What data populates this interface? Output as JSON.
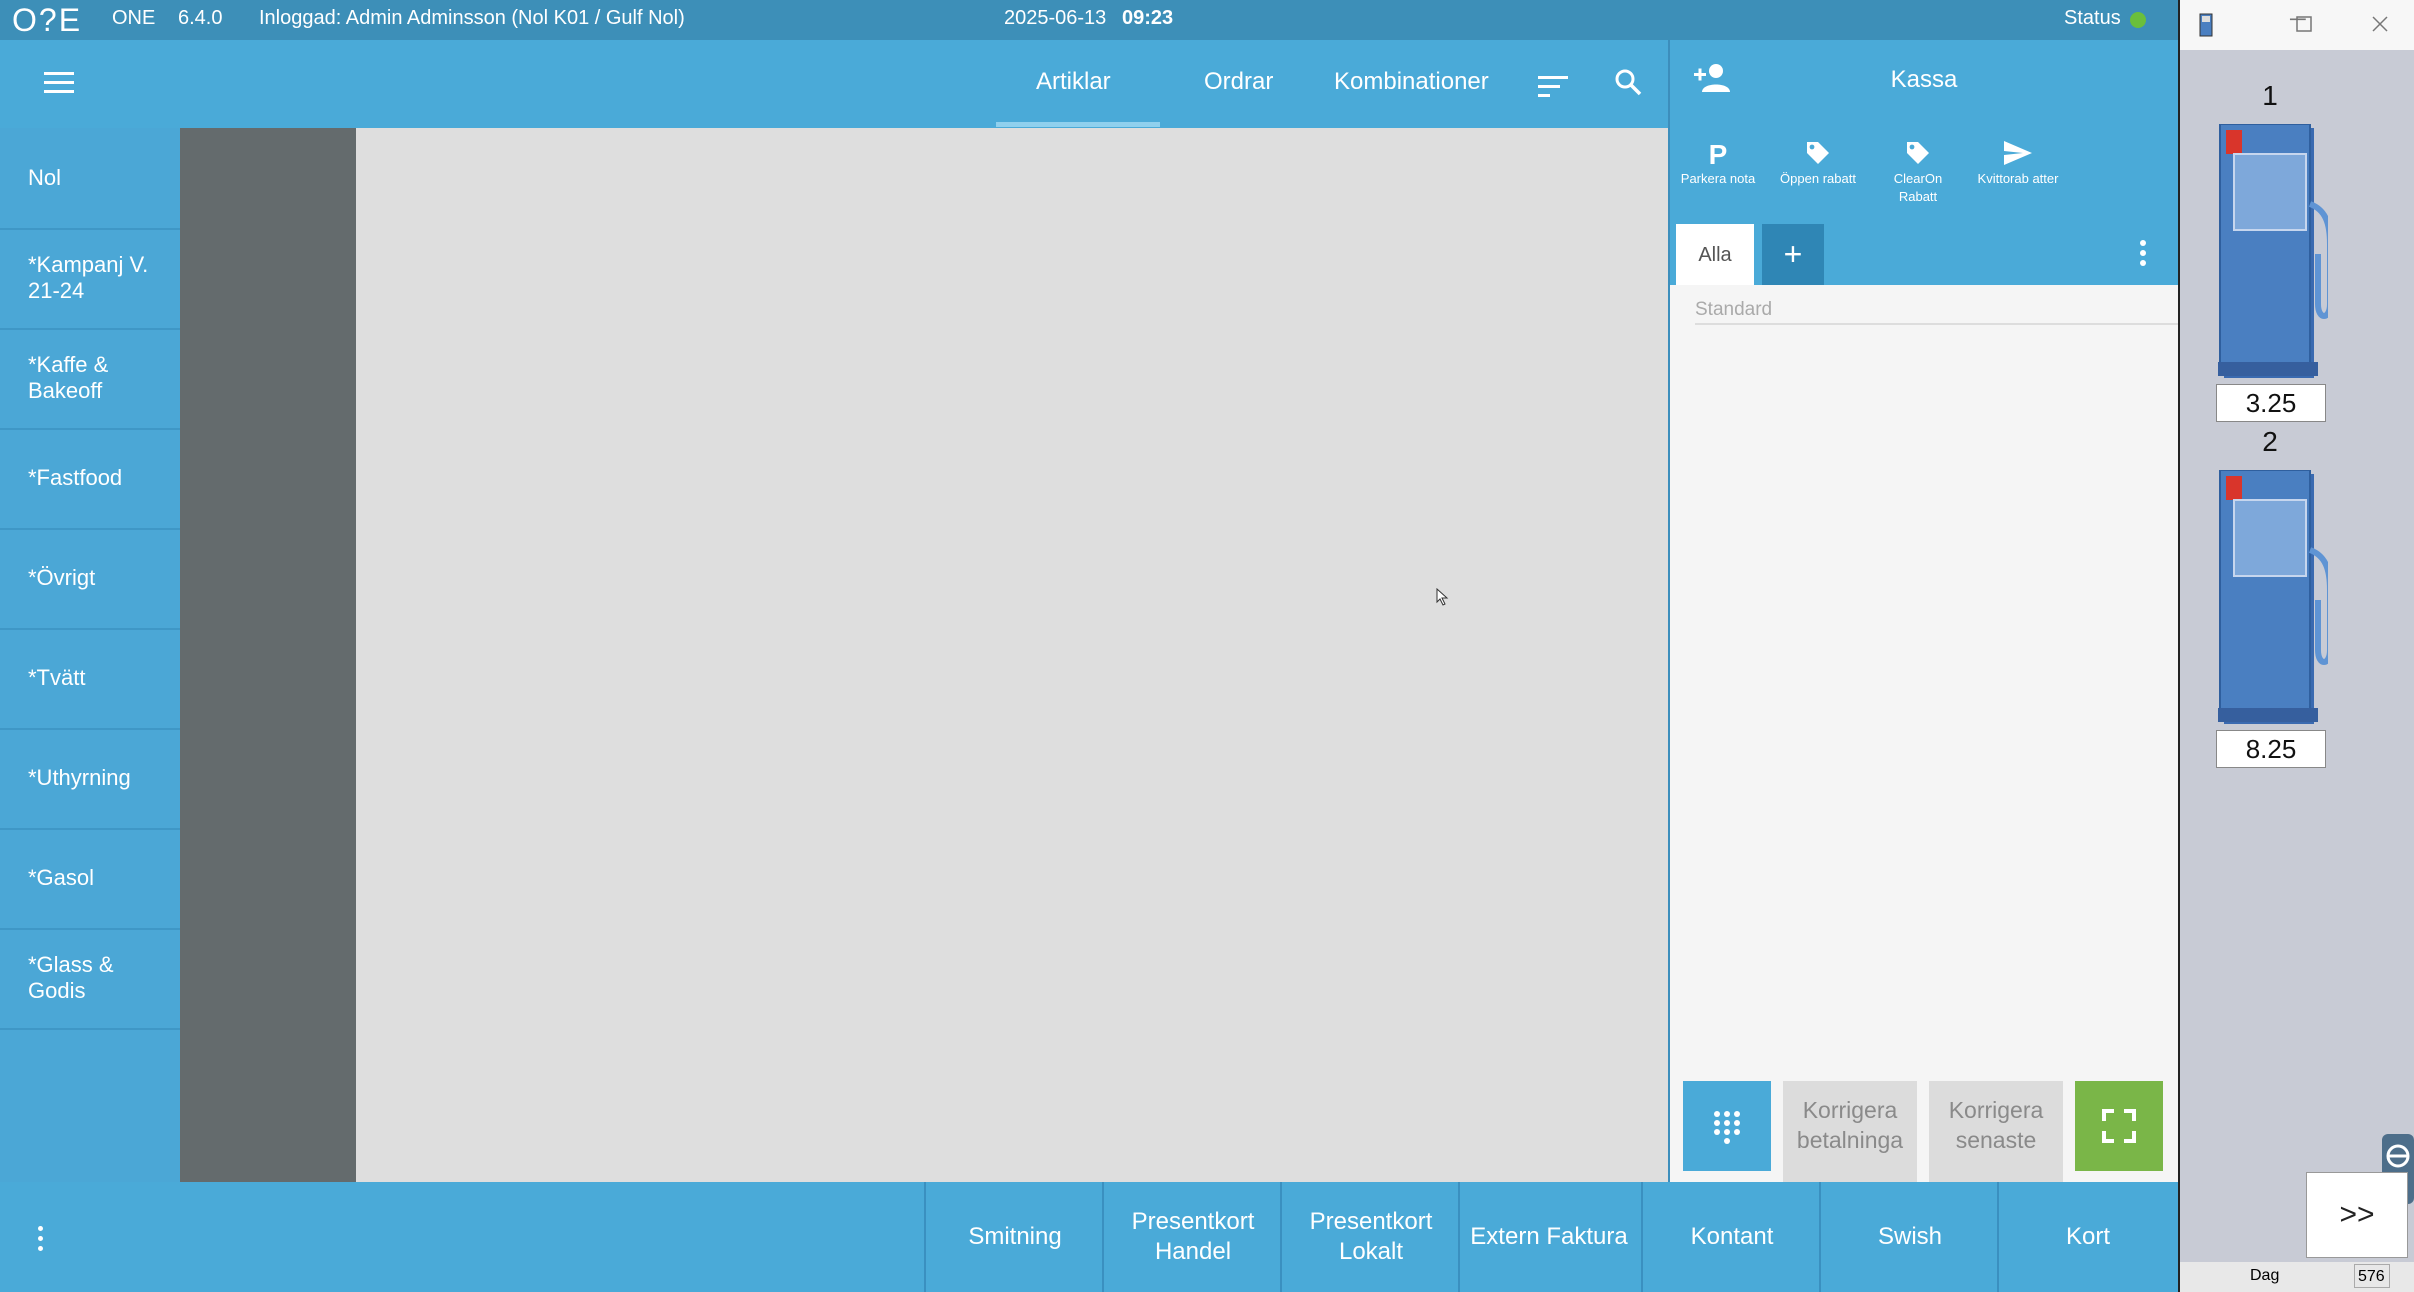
{
  "topbar": {
    "logo": "O?E",
    "brand": "ONE",
    "version": "6.4.0",
    "login": "Inloggad: Admin Adminsson (Nol K01 / Gulf Nol)",
    "date": "2025-06-13",
    "time": "09:23",
    "status_label": "Status",
    "status_color": "#6abf3c"
  },
  "nav": {
    "tabs": [
      "Artiklar",
      "Ordrar",
      "Kombinationer"
    ],
    "active_tab": "Artiklar"
  },
  "categories": [
    "Nol",
    "*Kampanj V. 21-24",
    "*Kaffe & Bakeoff",
    "*Fastfood",
    "*Övrigt",
    "*Tvätt",
    "*Uthyrning",
    "*Gasol",
    "*Glass & Godis"
  ],
  "kassa": {
    "title": "Kassa",
    "actions": [
      {
        "icon": "P",
        "label": "Parkera nota"
      },
      {
        "icon": "tag-icon",
        "label": "Öppen rabatt"
      },
      {
        "icon": "tag-icon",
        "label": "ClearOn Rabatt"
      },
      {
        "icon": "send-icon",
        "label": "Kvittorab atter"
      }
    ],
    "tab_all": "Alla",
    "tab_add": "+",
    "standard": "Standard",
    "footer": {
      "correct_payment": "Korrigera betalninga",
      "correct_last": "Korrigera senaste"
    }
  },
  "payments": [
    "Smitning",
    "Presentkort Handel",
    "Presentkort Lokalt",
    "Extern Faktura",
    "Kontant",
    "Swish",
    "Kort"
  ],
  "pumps": [
    {
      "number": "1",
      "value": "3.25"
    },
    {
      "number": "2",
      "value": "8.25"
    }
  ],
  "pump_window": {
    "more": ">>",
    "status_day": "Dag",
    "status_num": "576"
  },
  "colors": {
    "accent": "#4aaad8",
    "green": "#7ab648",
    "pump_blue": "#4a7fc1"
  }
}
